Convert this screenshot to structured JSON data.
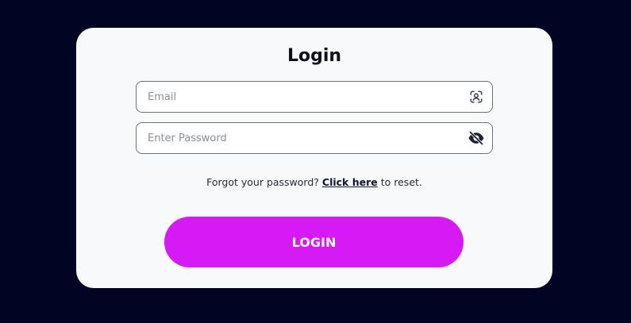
{
  "login": {
    "title": "Login",
    "email": {
      "placeholder": "Email",
      "value": "",
      "icon": "user-scan-icon"
    },
    "password": {
      "placeholder": "Enter Password",
      "value": "",
      "icon": "eye-off-icon"
    },
    "forgot": {
      "prefix": "Forgot your password? ",
      "link_text": "Click here",
      "suffix": " to reset."
    },
    "button_label": "LOGIN"
  },
  "colors": {
    "background": "#020424",
    "card": "#f8f9fa",
    "accent": "#d51af6"
  }
}
